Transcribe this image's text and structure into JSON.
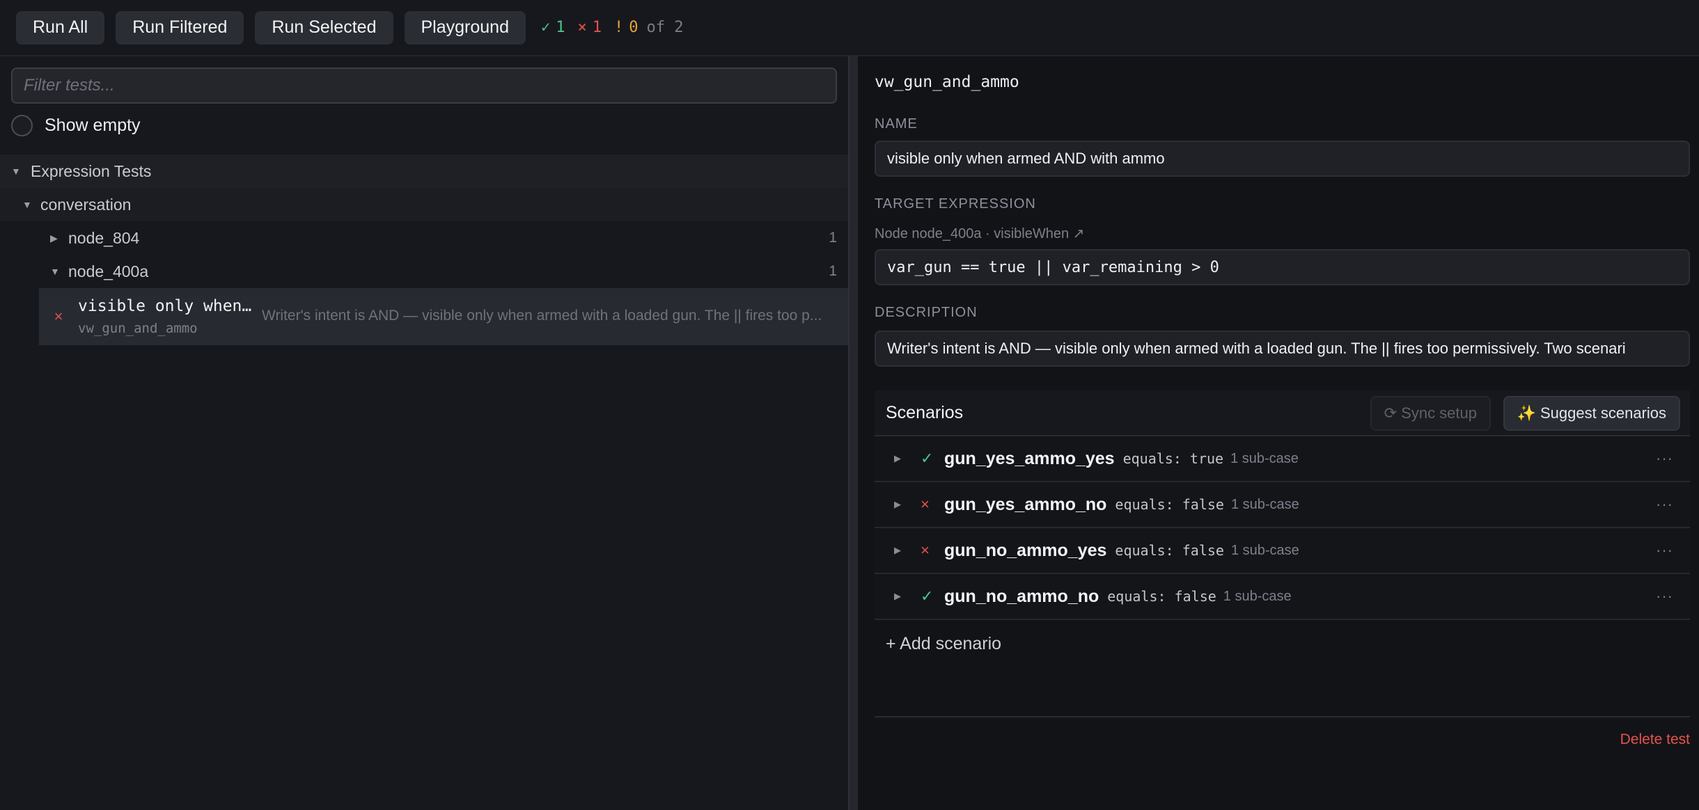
{
  "toolbar": {
    "run_all": "Run All",
    "run_filtered": "Run Filtered",
    "run_selected": "Run Selected",
    "playground": "Playground",
    "stats": {
      "pass_glyph": "✓",
      "pass_count": "1",
      "fail_glyph": "×",
      "fail_count": "1",
      "warn_glyph": "!",
      "warn_count": "0",
      "total_text": "of 2"
    }
  },
  "left": {
    "filter_placeholder": "Filter tests...",
    "show_empty_label": "Show empty",
    "tree": {
      "root_label": "Expression Tests",
      "group_label": "conversation",
      "nodes": [
        {
          "label": "node_804",
          "count": "1",
          "expanded": false
        },
        {
          "label": "node_400a",
          "count": "1",
          "expanded": true
        }
      ],
      "selected_test": {
        "title": "visible only when…",
        "id": "vw_gun_and_ammo",
        "description": "Writer's intent is AND — visible only when armed with a loaded gun. The || fires too p...",
        "status": "fail"
      }
    }
  },
  "right": {
    "test_id": "vw_gun_and_ammo",
    "name_label": "NAME",
    "name_value": "visible only when armed AND with ammo",
    "target_label": "TARGET EXPRESSION",
    "target_link": "Node node_400a · visibleWhen ↗",
    "target_value": "var_gun == true || var_remaining > 0",
    "description_label": "DESCRIPTION",
    "description_value": "Writer's intent is AND — visible only when armed with a loaded gun. The || fires too permissively. Two scenari",
    "scenarios_title": "Scenarios",
    "sync_setup": "⟳ Sync setup",
    "suggest_scenarios": "✨ Suggest scenarios",
    "scenarios": [
      {
        "name": "gun_yes_ammo_yes",
        "equals": "equals: true",
        "sub": "1 sub-case",
        "status": "pass",
        "glyph": "✓"
      },
      {
        "name": "gun_yes_ammo_no",
        "equals": "equals: false",
        "sub": "1 sub-case",
        "status": "fail",
        "glyph": "×"
      },
      {
        "name": "gun_no_ammo_yes",
        "equals": "equals: false",
        "sub": "1 sub-case",
        "status": "fail",
        "glyph": "×"
      },
      {
        "name": "gun_no_ammo_no",
        "equals": "equals: false",
        "sub": "1 sub-case",
        "status": "pass",
        "glyph": "✓"
      }
    ],
    "more_glyph": "···",
    "add_scenario": "+ Add scenario",
    "delete_test": "Delete test"
  },
  "colors": {
    "pass": "#4cc38a",
    "fail": "#e5534b",
    "warn": "#e3a33b",
    "background": "#17181d",
    "panel": "#121317"
  },
  "icons": {
    "caret_collapsed": "▶",
    "caret_expanded": "▼"
  }
}
